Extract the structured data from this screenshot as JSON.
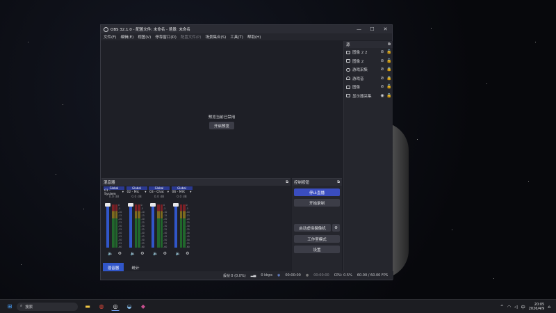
{
  "window": {
    "title": "OBS 32.1.0 - 配置文件: 未命名 - 场景: 未命名"
  },
  "menu": [
    "文件(F)",
    "编辑(E)",
    "视图(V)",
    "停靠窗口(D)",
    "配置文件(P)",
    "场景集合(S)",
    "工具(T)",
    "帮助(H)"
  ],
  "preview": {
    "disabled_text": "预览当前已禁用",
    "enable_label": "开启预览"
  },
  "sources": {
    "header": "源",
    "items": [
      {
        "name": "图像 2 2",
        "icon": "image-icon"
      },
      {
        "name": "图像 2",
        "icon": "image-icon"
      },
      {
        "name": "游戏采集",
        "icon": "gamepad-icon"
      },
      {
        "name": "游戏音",
        "icon": "cloud-icon"
      },
      {
        "name": "图像",
        "icon": "image-icon"
      },
      {
        "name": "显示器采集",
        "icon": "monitor-icon"
      }
    ]
  },
  "mixer": {
    "header": "混音器",
    "channels": [
      {
        "group": "Global",
        "name": "01 - System",
        "db": "0.0 dB"
      },
      {
        "group": "Global",
        "name": "02 - Mic",
        "db": "0.0 dB"
      },
      {
        "group": "Global",
        "name": "03 - Chat",
        "db": "0.0 dB"
      },
      {
        "group": "Global",
        "name": "06 - MIX",
        "db": "0.0 dB"
      }
    ],
    "ticks": [
      "0",
      "-5",
      "-10",
      "-15",
      "-20",
      "-25",
      "-30",
      "-35",
      "-40",
      "-45",
      "-50",
      "-55",
      "-60"
    ],
    "tabs": [
      {
        "label": "混音器"
      },
      {
        "label": "统计"
      }
    ]
  },
  "controls": {
    "header": "控制按钮",
    "stop_stream": "停止直播",
    "start_record": "开始录制",
    "start_vcam": "启动虚拟摄像机",
    "studio_mode": "工作室模式",
    "settings": "设置"
  },
  "status": {
    "dropped": "丢帧 0 (0.0%)",
    "bitrate": "0 kbps",
    "stream_time": "00:00:00",
    "rec_time": "00:00:00",
    "cpu": "CPU: 0.5%",
    "fps": "60.00 / 60.00 FPS"
  },
  "taskbar": {
    "search": "搜索",
    "ime": "中",
    "time": "20:05",
    "date": "2026/4/9"
  }
}
